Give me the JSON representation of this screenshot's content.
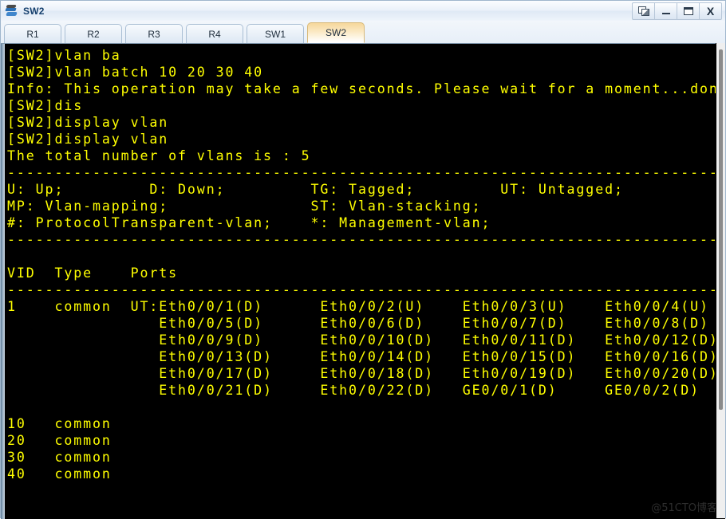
{
  "window": {
    "title": "SW2",
    "icon": "switch-icon",
    "buttons": [
      {
        "name": "restore-button",
        "icon": "restore-icon",
        "label": ""
      },
      {
        "name": "minimize-button",
        "icon": "minimize-icon",
        "label": ""
      },
      {
        "name": "maximize-button",
        "icon": "maximize-icon",
        "label": ""
      },
      {
        "name": "close-button",
        "icon": "close-icon",
        "label": "X"
      }
    ]
  },
  "tabs": {
    "items": [
      {
        "label": "R1",
        "active": false
      },
      {
        "label": "R2",
        "active": false
      },
      {
        "label": "R3",
        "active": false
      },
      {
        "label": "R4",
        "active": false
      },
      {
        "label": "SW1",
        "active": false
      },
      {
        "label": "SW2",
        "active": true
      }
    ],
    "active_label": "SW2"
  },
  "terminal": {
    "foreground_color": "#ffff00",
    "background_color": "#000000",
    "prompt": "[SW2]",
    "lines": [
      "[SW2]vlan ba",
      "[SW2]vlan batch 10 20 30 40",
      "Info: This operation may take a few seconds. Please wait for a moment...done.",
      "[SW2]dis",
      "[SW2]display vlan",
      "[SW2]display vlan",
      "The total number of vlans is : 5",
      "-------------------------------------------------------------------------------",
      "U: Up;         D: Down;         TG: Tagged;         UT: Untagged;",
      "MP: Vlan-mapping;               ST: Vlan-stacking;",
      "#: ProtocolTransparent-vlan;    *: Management-vlan;",
      "-------------------------------------------------------------------------------",
      "",
      "VID  Type    Ports",
      "-------------------------------------------------------------------------------",
      "1    common  UT:Eth0/0/1(D)      Eth0/0/2(U)    Eth0/0/3(U)    Eth0/0/4(U)",
      "                Eth0/0/5(D)      Eth0/0/6(D)    Eth0/0/7(D)    Eth0/0/8(D)",
      "                Eth0/0/9(D)      Eth0/0/10(D)   Eth0/0/11(D)   Eth0/0/12(D)",
      "                Eth0/0/13(D)     Eth0/0/14(D)   Eth0/0/15(D)   Eth0/0/16(D)",
      "                Eth0/0/17(D)     Eth0/0/18(D)   Eth0/0/19(D)   Eth0/0/20(D)",
      "                Eth0/0/21(D)     Eth0/0/22(D)   GE0/0/1(D)     GE0/0/2(D)",
      "",
      "10   common",
      "20   common",
      "30   common",
      "40   common"
    ],
    "vlan_summary": {
      "total_vlans": "5",
      "columns": [
        "VID",
        "Type",
        "Ports"
      ],
      "rows": [
        {
          "vid": "1",
          "type": "common",
          "tag_mode": "UT:",
          "ports": [
            "Eth0/0/1(D)",
            "Eth0/0/2(U)",
            "Eth0/0/3(U)",
            "Eth0/0/4(U)",
            "Eth0/0/5(D)",
            "Eth0/0/6(D)",
            "Eth0/0/7(D)",
            "Eth0/0/8(D)",
            "Eth0/0/9(D)",
            "Eth0/0/10(D)",
            "Eth0/0/11(D)",
            "Eth0/0/12(D)",
            "Eth0/0/13(D)",
            "Eth0/0/14(D)",
            "Eth0/0/15(D)",
            "Eth0/0/16(D)",
            "Eth0/0/17(D)",
            "Eth0/0/18(D)",
            "Eth0/0/19(D)",
            "Eth0/0/20(D)",
            "Eth0/0/21(D)",
            "Eth0/0/22(D)",
            "GE0/0/1(D)",
            "GE0/0/2(D)"
          ]
        },
        {
          "vid": "10",
          "type": "common",
          "tag_mode": "",
          "ports": []
        },
        {
          "vid": "20",
          "type": "common",
          "tag_mode": "",
          "ports": []
        },
        {
          "vid": "30",
          "type": "common",
          "tag_mode": "",
          "ports": []
        },
        {
          "vid": "40",
          "type": "common",
          "tag_mode": "",
          "ports": []
        }
      ]
    },
    "legend": {
      "U": "Up;",
      "D": "Down;",
      "TG": "Tagged;",
      "UT": "Untagged;",
      "MP": "Vlan-mapping;",
      "ST": "Vlan-stacking;",
      "hash": "ProtocolTransparent-vlan;",
      "star": "Management-vlan;"
    }
  },
  "watermark": {
    "text": "@51CTO博客"
  },
  "scrollbar": {
    "orientation": "vertical"
  }
}
